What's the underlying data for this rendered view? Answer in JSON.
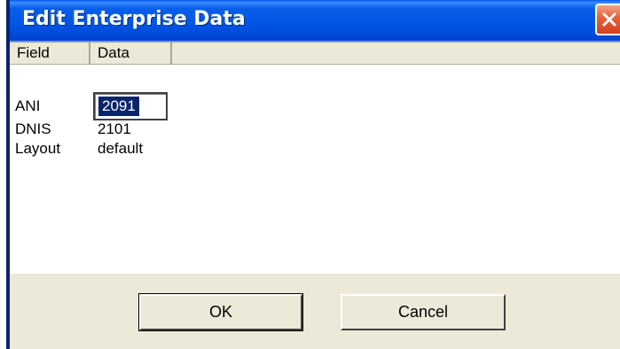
{
  "window": {
    "title": "Edit Enterprise Data",
    "close_icon": "close-x-icon"
  },
  "list": {
    "columns": [
      {
        "label": "Field"
      },
      {
        "label": "Data"
      }
    ],
    "rows": [
      {
        "field": "ANI",
        "data": "2091"
      },
      {
        "field": "DNIS",
        "data": "2101"
      },
      {
        "field": "Layout",
        "data": "default"
      }
    ],
    "editing": {
      "row_index": 0,
      "value": "2091"
    }
  },
  "buttons": {
    "ok_label": "OK",
    "cancel_label": "Cancel"
  },
  "colors": {
    "titlebar": "#0055e5",
    "selection": "#0a246a",
    "close_button": "#e5643f",
    "dialog_face": "#ece9d8"
  }
}
